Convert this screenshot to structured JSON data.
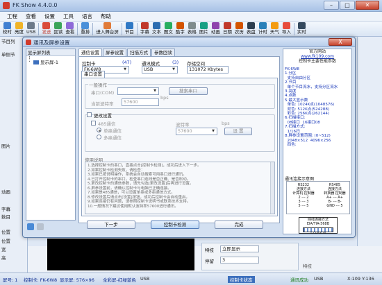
{
  "app": {
    "title": "FK Show 4.4.0.0",
    "menu": [
      "工程",
      "查看",
      "设置",
      "工具",
      "语言",
      "帮助"
    ],
    "toolbar": [
      {
        "label": "校时",
        "color": "#3f7fd1"
      },
      {
        "label": "亮度",
        "color": "#f0b429"
      },
      {
        "label": "USB",
        "color": "#6c7a8a"
      },
      {
        "label": "发送",
        "color": "#d94b3a",
        "emphasis": true
      },
      {
        "label": "回读",
        "color": "#3aa55a"
      },
      {
        "label": "查看",
        "color": "#8e6ad8"
      },
      {
        "label": "重排",
        "color": "#4a90d9"
      },
      {
        "label": "进入舞台屏",
        "color": "#e07b39"
      },
      {
        "label": "节目",
        "color": "#2f78c4"
      },
      {
        "label": "字幕",
        "color": "#c0392b"
      },
      {
        "label": "文本",
        "color": "#2b6cb0"
      },
      {
        "label": "图文",
        "color": "#27ae60"
      },
      {
        "label": "酷字",
        "color": "#d35400"
      },
      {
        "label": "表格",
        "color": "#7f8c8d"
      },
      {
        "label": "图片",
        "color": "#16a085"
      },
      {
        "label": "动画",
        "color": "#8e44ad"
      },
      {
        "label": "日期",
        "color": "#c0392b"
      },
      {
        "label": "农历",
        "color": "#d35400"
      },
      {
        "label": "表盘",
        "color": "#2c3e50"
      },
      {
        "label": "计时",
        "color": "#2980b9"
      },
      {
        "label": "天气",
        "color": "#f39c12"
      },
      {
        "label": "导入",
        "color": "#e74c3c"
      },
      {
        "label": "实时",
        "color": "#34495e"
      }
    ],
    "left_labels": [
      "节目列",
      "单侧节",
      "图片",
      "动画",
      "字幕",
      "数目",
      "位置",
      "位置",
      "宽",
      "高"
    ],
    "status": {
      "screen": "屏号: 1",
      "card": "控制卡: FK-6W8",
      "display": "显示屏: 576×96",
      "color": "全彩屏-红绿蓝色",
      "link": "USB",
      "card_status": "控制卡状态",
      "comm": "通讯成功",
      "comm_link": "USB",
      "coords": "X:109 Y:136"
    },
    "bottom_form": {
      "rows": [
        {
          "label": "特技",
          "value": "立即显示"
        },
        {
          "label": "停留",
          "value": "3"
        }
      ],
      "right_label": "特技"
    }
  },
  "dialog": {
    "title": "通讯及屏参设置",
    "close_label": "X",
    "tree": {
      "header": "显示屏列表",
      "items": [
        "显示屏-1"
      ]
    },
    "tabs": [
      "通信设置",
      "屏参设置",
      "扫描方式",
      "参数回读"
    ],
    "active_tab": 0,
    "fields": {
      "controller_label": "控制卡",
      "controller_count": "(47)",
      "controller_value": "FK-6W8",
      "comm_mode_label": "通讯模式",
      "comm_mode_count": "(3)",
      "comm_mode_value": "USB",
      "storage_label": "存储空间",
      "storage_value": "131072 Kbytes"
    },
    "subtab": "串口设置",
    "general": {
      "title": "一般操作",
      "port_label": "串口(COM)",
      "search_button": "搜索串口",
      "baud_label": "当前波特率",
      "baud_value": "57600",
      "bps": "bps"
    },
    "change": {
      "checkbox_label": "更改设置",
      "rs485_label": "485通信",
      "single_label": "单串通信",
      "multi_label": "多串通信",
      "baud_label": "波特率",
      "baud_value": "57600",
      "bps": "bps",
      "set_button": "设 置"
    },
    "usage": {
      "title": "使用说明",
      "lines": [
        "1.选择控制卡的串口，直接点击[控制卡检测]，成功后进入下一步。",
        "2.如果控制卡检测失败，请检查：",
        "3.如果已按说明操作，系统会自动搜索可用串口进行通讯。",
        "4.已打开控制卡的串口，检查串口连线是否正确、是否松动。",
        "5.更改控制卡的通信参数，请先勾选[更改设置]后再进行设置。",
        "6.屏参设置前，请确认控制卡与电脑已正确连接。",
        "7.如果是485通信，可以设置单串或多串通信方式。",
        "8.修改设置后请点击[设置]按钮，成功后控制卡会自动重启。",
        "9.如果连接仍有问题，请参照控制卡说明书或联系技术支持。",
        "10.一般情况下建议使用默认波特率57600进行通讯。"
      ]
    },
    "buttons": {
      "next": "下一步",
      "detect": "控制卡检测",
      "done": "完成"
    },
    "info": {
      "header_line1": "官方网站",
      "header_line2": "www.fk109.com",
      "header_line3": "控制卡主要性能参数",
      "text_lines": [
        "FK-6W8",
        "1.分区",
        "  支持自由分区",
        "2.节目",
        "  单个节目流水，支持分区流水",
        "3.亮度",
        "4.点数",
        "5.最大显示数",
        "  单色: 1024K点(1048576)",
        "  双色: 512K点(524288)",
        "  彩色: 256K点(262144)",
        "6.扫描接口:",
        "  08接口  16接口08",
        "7.扫描方式:",
        "  1/16扫",
        "8.屏参设置范围: (0~512)",
        "  2048×512  4096×256",
        "  四色:"
      ],
      "diagram_label": "通讯连接示意图",
      "diagram": {
        "rs232_title": "RS232",
        "rs232_sub": "连接方法",
        "rs485_title": "RS485",
        "rs485_sub": "连接方法",
        "left_cols": [
          "计算机",
          "控制器"
        ],
        "right_cols": [
          "转换器",
          "控制器"
        ],
        "rows": [
          "2 --- 2",
          "3 --- 3",
          "5 --- 5"
        ],
        "rows_right": [
          "A+ --- A+",
          "B- --- B-",
          "GND --- 5"
        ]
      },
      "net_title": "网线连接方法",
      "net_sub": "EIA/TIA-568B",
      "net_pins": "12345678"
    }
  }
}
